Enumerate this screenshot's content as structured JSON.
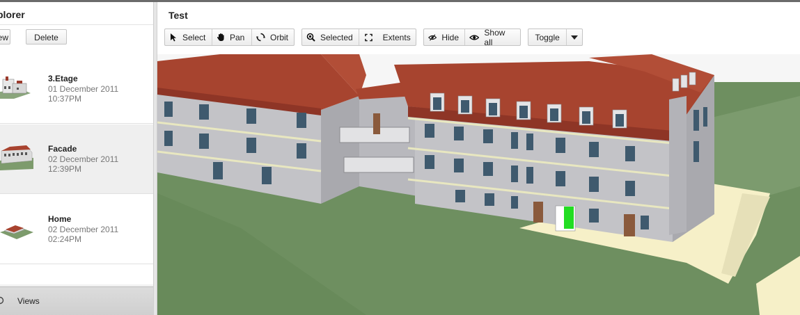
{
  "explorer": {
    "title": "plorer",
    "new_label": "ew",
    "delete_label": "Delete",
    "items": [
      {
        "name": "3.Etage",
        "date": "01 December 2011",
        "time": "10:37PM"
      },
      {
        "name": "Facade",
        "date": "02 December 2011",
        "time": "12:39PM"
      },
      {
        "name": "Home",
        "date": "02 December 2011",
        "time": "02:24PM"
      }
    ],
    "views_label": "Views"
  },
  "viewer": {
    "title": "Test",
    "toolbar": {
      "select": "Select",
      "pan": "Pan",
      "orbit": "Orbit",
      "selected": "Selected",
      "extents": "Extents",
      "hide": "Hide",
      "show_all": "Show all",
      "toggle": "Toggle"
    }
  },
  "colors": {
    "roof": "#a7442f",
    "wall": "#c3c3c7",
    "ground": "#6e8f60",
    "sky": "#f6f6f6",
    "pavement": "#f6f0c8",
    "highlight_door": "#22dd22"
  },
  "icons": [
    "cursor-arrow-icon",
    "hand-icon",
    "orbit-icon",
    "zoom-selected-icon",
    "extents-icon",
    "hide-eye-icon",
    "eye-icon",
    "chevron-down-icon"
  ]
}
